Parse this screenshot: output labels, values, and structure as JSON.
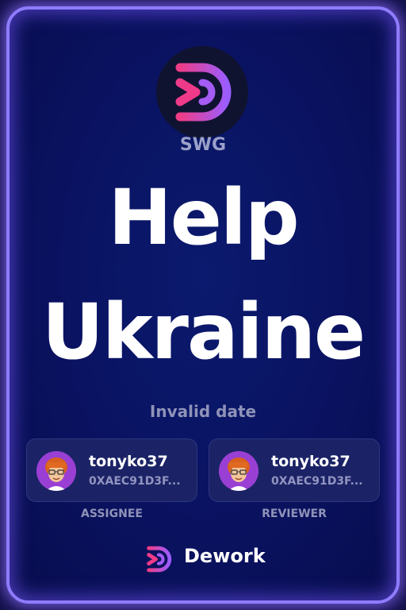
{
  "org": {
    "name": "SWG",
    "logo_icon": "dework-logo-icon"
  },
  "title": {
    "line1": "Help",
    "line2": "Ukraine"
  },
  "date_text": "Invalid date",
  "assignee": {
    "username": "tonyko37",
    "address": "0XAEC91D3F...",
    "role_label": "ASSIGNEE",
    "avatar_icon": "avatar-icon"
  },
  "reviewer": {
    "username": "tonyko37",
    "address": "0XAEC91D3F...",
    "role_label": "REVIEWER",
    "avatar_icon": "avatar-icon"
  },
  "brand": {
    "name": "Dework",
    "icon": "dework-logo-icon"
  },
  "colors": {
    "background": "#0a1260",
    "border_glow": "#8f7cff",
    "card": "#1b2366",
    "logo_pink": "#e83a8c",
    "logo_purple": "#9b5cff"
  }
}
